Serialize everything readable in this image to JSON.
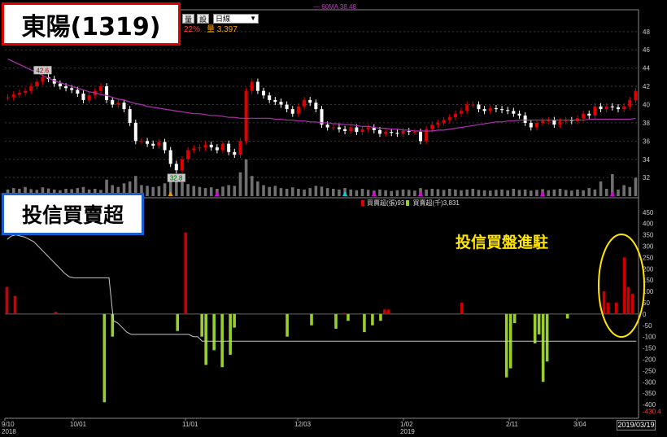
{
  "title": "東陽(1319)",
  "subtitle": "投信買賣超",
  "annotation": "投信買盤進駐",
  "toolbar": {
    "btn1": "量",
    "btn2": "設",
    "period": "日線"
  },
  "price_info": {
    "pct": "22%",
    "volume_label": "量 3,397"
  },
  "ma_legend": "60MA 38.48",
  "inst_legend": {
    "a": "買賣超(張)93",
    "b": "買賣超(千)3,831"
  },
  "current_date": "2019/03/19",
  "colors": {
    "up": "#e00000",
    "down": "#ffffff",
    "ma": "#b030b0",
    "inst_buy": "#cc0000",
    "inst_sell": "#9acd32",
    "cum_line": "#c8c8c8",
    "axis": "#888888",
    "grid": "#3a3a3a"
  },
  "chart_data": [
    {
      "type": "candlestick",
      "title": "",
      "x_tick_labels": [
        "9/10\n2018",
        "10/01",
        "11/01",
        "12/03",
        "1/02\n2019",
        "2/11",
        "3/04"
      ],
      "y_tick_labels": [
        "32",
        "34",
        "36",
        "38",
        "40",
        "42",
        "44",
        "46",
        "48"
      ],
      "ylim": [
        30.5,
        49.5
      ],
      "annotations": [
        "42.6",
        "32.8"
      ],
      "close": [
        40.8,
        41.1,
        41.3,
        41.5,
        42,
        42.5,
        43,
        42.8,
        42.3,
        42,
        41.8,
        41.6,
        41.2,
        40.5,
        41,
        41.5,
        42,
        40.5,
        40,
        40.2,
        39.5,
        38,
        36,
        36,
        35.7,
        35.5,
        35.9,
        35,
        33.5,
        32.8,
        34,
        35,
        35.2,
        35.3,
        35.6,
        35.3,
        35,
        35.7,
        34.8,
        34.5,
        36,
        41.5,
        42.5,
        41.5,
        41,
        40.5,
        40.3,
        40,
        39.5,
        39,
        39.8,
        40.5,
        40.2,
        39.5,
        37.8,
        37.5,
        37.5,
        37.3,
        37.1,
        37.5,
        37,
        37.3,
        37.5,
        37.2,
        36.8,
        37,
        36.9,
        36.8,
        37.1,
        37,
        37,
        36,
        37.3,
        37.8,
        38,
        38.3,
        38.6,
        39,
        39.3,
        40,
        40,
        39.5,
        39.3,
        39.6,
        39.5,
        39.4,
        39.3,
        39,
        38.8,
        38,
        37.5,
        38,
        38.2,
        38.3,
        37.8,
        38.2,
        38.3,
        38.2,
        38.5,
        39,
        38.8,
        39.8,
        39.5,
        39.8,
        39.7,
        39.5,
        39.8,
        40.5,
        41.5
      ],
      "ma60": [
        45,
        44.7,
        44.4,
        44.1,
        43.8,
        43.5,
        43.2,
        42.9,
        42.6,
        42.4,
        42.2,
        42,
        41.8,
        41.6,
        41.4,
        41.3,
        41.1,
        41,
        40.8,
        40.6,
        40.5,
        40.3,
        40.1,
        40,
        39.8,
        39.7,
        39.6,
        39.5,
        39.4,
        39.3,
        39.2,
        39.1,
        39,
        39,
        38.9,
        38.8,
        38.8,
        38.7,
        38.6,
        38.6,
        38.5,
        38.5,
        38.5,
        38.5,
        38.5,
        38.5,
        38.4,
        38.4,
        38.3,
        38.3,
        38.2,
        38.2,
        38.1,
        38.1,
        38,
        38,
        37.9,
        37.9,
        37.8,
        37.8,
        37.7,
        37.6,
        37.6,
        37.5,
        37.4,
        37.4,
        37.3,
        37.3,
        37.2,
        37.2,
        37.1,
        37.1,
        37.1,
        37.1,
        37.2,
        37.2,
        37.3,
        37.4,
        37.5,
        37.6,
        37.7,
        37.8,
        37.9,
        38,
        38.1,
        38.1,
        38.2,
        38.2,
        38.3,
        38.3,
        38.3,
        38.3,
        38.3,
        38.3,
        38.3,
        38.3,
        38.3,
        38.3,
        38.3,
        38.3,
        38.4,
        38.4,
        38.4,
        38.4,
        38.4,
        38.4,
        38.4,
        38.4,
        38.48
      ],
      "volume": [
        18,
        22,
        20,
        25,
        19,
        17,
        24,
        21,
        18,
        16,
        20,
        19,
        22,
        25,
        18,
        20,
        17,
        45,
        30,
        25,
        35,
        40,
        55,
        30,
        28,
        25,
        27,
        35,
        60,
        45,
        38,
        33,
        28,
        25,
        22,
        24,
        20,
        26,
        30,
        28,
        65,
        100,
        55,
        40,
        30,
        25,
        28,
        22,
        20,
        24,
        20,
        18,
        22,
        28,
        26,
        22,
        20,
        18,
        22,
        18,
        16,
        20,
        17,
        15,
        18,
        16,
        14,
        16,
        18,
        17,
        15,
        22,
        18,
        20,
        19,
        17,
        20,
        18,
        16,
        18,
        20,
        17,
        16,
        15,
        17,
        18,
        16,
        20,
        17,
        18,
        15,
        17,
        19,
        16,
        18,
        20,
        17,
        15,
        18,
        16,
        22,
        18,
        40,
        20,
        60,
        18,
        30,
        25,
        50
      ]
    },
    {
      "type": "bar",
      "title": "",
      "ylabel": "",
      "y_tick_labels": [
        "450",
        "400",
        "350",
        "300",
        "250",
        "200",
        "150",
        "100",
        "50",
        "0",
        "-50",
        "-100",
        "-150",
        "-200",
        "-250",
        "-300",
        "-350",
        "-400"
      ],
      "ylim": [
        -450,
        460
      ],
      "annotations": [
        "-430.4"
      ],
      "inst_net": [
        120,
        0,
        80,
        0,
        0,
        0,
        0,
        0,
        0,
        0,
        0,
        0,
        10,
        0,
        0,
        0,
        0,
        0,
        0,
        0,
        0,
        0,
        0,
        0,
        -390,
        0,
        -100,
        0,
        0,
        0,
        0,
        0,
        0,
        0,
        0,
        0,
        0,
        0,
        0,
        0,
        0,
        0,
        -75,
        0,
        360,
        0,
        0,
        0,
        -100,
        -225,
        0,
        -160,
        0,
        -235,
        0,
        -180,
        -60,
        0,
        0,
        0,
        0,
        0,
        0,
        0,
        0,
        0,
        0,
        0,
        0,
        -100,
        0,
        0,
        0,
        0,
        0,
        -50,
        0,
        0,
        0,
        0,
        0,
        -65,
        0,
        5,
        -30,
        0,
        0,
        0,
        -80,
        0,
        -50,
        0,
        -30,
        20,
        20,
        0,
        0,
        0,
        0,
        0,
        0,
        0,
        0,
        0,
        0,
        0,
        0,
        0,
        0,
        0,
        0,
        0,
        50,
        0,
        0,
        0,
        0,
        0,
        0,
        0,
        0,
        0,
        0,
        -280,
        -240,
        -40,
        0,
        0,
        0,
        0,
        -130,
        -90,
        -300,
        -210,
        0,
        0,
        0,
        0,
        -20,
        0,
        0,
        0,
        0,
        0,
        0,
        0,
        0,
        100,
        50,
        0,
        50,
        0,
        250,
        120,
        90,
        0
      ],
      "cumulative": [
        330,
        345,
        350,
        345,
        340,
        330,
        320,
        300,
        280,
        260,
        240,
        220,
        200,
        180,
        165,
        160,
        160,
        160,
        160,
        160,
        160,
        160,
        160,
        160,
        -30,
        -40,
        -60,
        -80,
        -90,
        -90,
        -90,
        -90,
        -90,
        -90,
        -90,
        -90,
        -90,
        -90,
        -90,
        -90,
        -90,
        -90,
        -100,
        -100,
        -120,
        -120,
        -120,
        -120,
        -120,
        -120,
        -120,
        -120,
        -120,
        -120,
        -120,
        -120,
        -120,
        -120,
        -120,
        -120,
        -120,
        -120,
        -120,
        -120,
        -120,
        -120,
        -120,
        -120,
        -120,
        -120,
        -120,
        -120,
        -120,
        -120,
        -120,
        -120,
        -120,
        -120,
        -120,
        -120,
        -120,
        -120,
        -120,
        -120,
        -120,
        -120,
        -120,
        -120,
        -120,
        -120,
        -120,
        -120,
        -120,
        -120,
        -120,
        -120,
        -120,
        -120,
        -120,
        -120,
        -120,
        -120,
        -120,
        -120,
        -120,
        -120,
        -120,
        -120,
        -120,
        -120,
        -120,
        -120,
        -120,
        -120,
        -120,
        -120,
        -120,
        -120,
        -120,
        -120,
        -120,
        -120,
        -120,
        -120,
        -120,
        -120,
        -120,
        -120,
        -120,
        -120,
        -120,
        -120,
        -120,
        -120,
        -120,
        -120,
        -120,
        -120,
        -120,
        -120,
        -120,
        -120,
        -120
      ]
    }
  ]
}
